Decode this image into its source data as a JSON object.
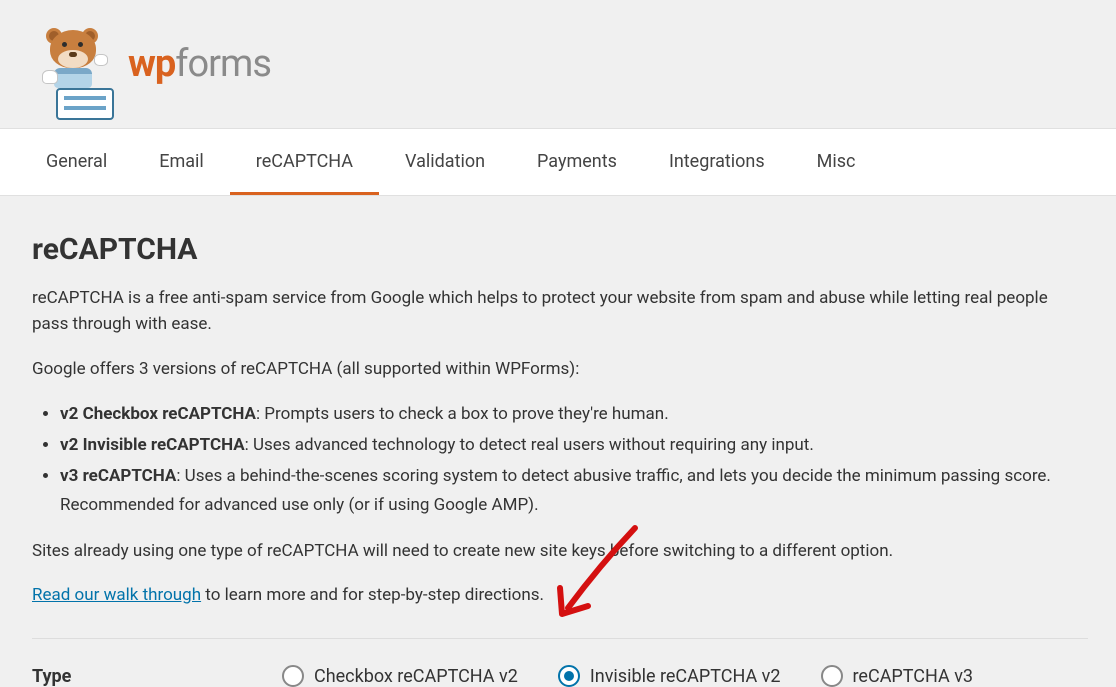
{
  "logo": {
    "wp": "wp",
    "forms": "forms"
  },
  "tabs": [
    {
      "label": "General"
    },
    {
      "label": "Email"
    },
    {
      "label": "reCAPTCHA"
    },
    {
      "label": "Validation"
    },
    {
      "label": "Payments"
    },
    {
      "label": "Integrations"
    },
    {
      "label": "Misc"
    }
  ],
  "section": {
    "title": "reCAPTCHA",
    "intro": "reCAPTCHA is a free anti-spam service from Google which helps to protect your website from spam and abuse while letting real people pass through with ease.",
    "versions_lead": "Google offers 3 versions of reCAPTCHA (all supported within WPForms):",
    "bullets": [
      {
        "bold": "v2 Checkbox reCAPTCHA",
        "rest": ": Prompts users to check a box to prove they're human."
      },
      {
        "bold": "v2 Invisible reCAPTCHA",
        "rest": ": Uses advanced technology to detect real users without requiring any input."
      },
      {
        "bold": "v3 reCAPTCHA",
        "rest": ": Uses a behind-the-scenes scoring system to detect abusive traffic, and lets you decide the minimum passing score. Recommended for advanced use only (or if using Google AMP)."
      }
    ],
    "switch_note": "Sites already using one type of reCAPTCHA will need to create new site keys before switching to a different option.",
    "link_text": "Read our walk through",
    "link_rest": " to learn more and for step-by-step directions."
  },
  "type_field": {
    "label": "Type",
    "options": [
      {
        "label": "Checkbox reCAPTCHA v2",
        "selected": false
      },
      {
        "label": "Invisible reCAPTCHA v2",
        "selected": true
      },
      {
        "label": "reCAPTCHA v3",
        "selected": false
      }
    ]
  }
}
